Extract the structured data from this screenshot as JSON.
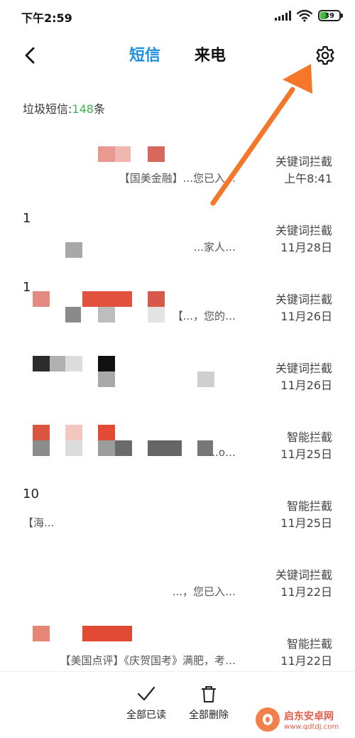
{
  "status_bar": {
    "time": "下午2:59",
    "battery_level": "39"
  },
  "nav": {
    "tabs": [
      "短信",
      "来电"
    ],
    "active_tab": 0
  },
  "summary": {
    "prefix": "垃圾短信:",
    "count": "148",
    "suffix": "条"
  },
  "messages": [
    {
      "sender": "",
      "preview": "【国美金融】...您已入…",
      "tag": "关键词拦截",
      "time": "上午8:41"
    },
    {
      "sender": "1",
      "preview": "...家人…",
      "tag": "关键词拦截",
      "time": "11月28日"
    },
    {
      "sender": "1",
      "preview": "【...，您的…",
      "tag": "关键词拦截",
      "time": "11月26日"
    },
    {
      "sender": "",
      "preview": "",
      "tag": "关键词拦截",
      "time": "11月26日"
    },
    {
      "sender": "",
      "preview": "...o…",
      "tag": "智能拦截",
      "time": "11月25日"
    },
    {
      "sender": "10",
      "preview": "【海...",
      "tag": "智能拦截",
      "time": "11月25日"
    },
    {
      "sender": "",
      "preview": "...，您已入…",
      "tag": "关键词拦截",
      "time": "11月22日"
    },
    {
      "sender": "",
      "preview": "【美国点评】《庆贺国考》满肥，考…",
      "tag": "智能拦截",
      "time": "11月22日"
    }
  ],
  "bottom_actions": {
    "mark_read": "全部已读",
    "delete_all": "全部删除"
  },
  "watermark": {
    "title": "启东安卓网",
    "url": "www.qdtdj.com"
  },
  "colors": {
    "accent": "#1f8fe0",
    "count": "#3bb54a",
    "arrow": "#f5782a"
  }
}
